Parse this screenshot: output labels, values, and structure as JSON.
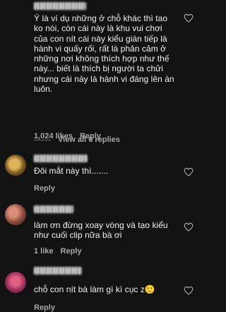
{
  "comments": [
    {
      "text_lines": [
        "Ý là ví dụ những ở chỗ khác thì tao",
        "ko nói, còn cái này là khu vui chơi",
        "của con nít cái này kiểu gián tiếp là",
        "hành vi quấy rối, rất là phản cảm ở",
        "những nơi không thích hợp như thế",
        "này... biết là thích bị người ta chửi",
        "nhưng cái này là hành vi đáng lên án",
        "luôn."
      ],
      "likes": "1,024 likes",
      "reply_label": "Reply",
      "view_replies": "View all 6 replies"
    },
    {
      "text_lines": [
        "Đôi mắt này thì......."
      ],
      "reply_label": "Reply"
    },
    {
      "text_lines": [
        "làm ơn đừng xoay vòng và tạo kiểu",
        "như cuối clip nữa bà ơi"
      ],
      "likes": "1 like",
      "reply_label": "Reply"
    },
    {
      "text_lines": [
        "chỗ con nít bà làm gì kì cục z🙂"
      ],
      "reply_label": "Reply"
    }
  ],
  "colors": {
    "background": "#121212",
    "text": "#f2f2f2",
    "muted": "#a8a8a8"
  },
  "icons": [
    "heart-icon",
    "avatar"
  ]
}
